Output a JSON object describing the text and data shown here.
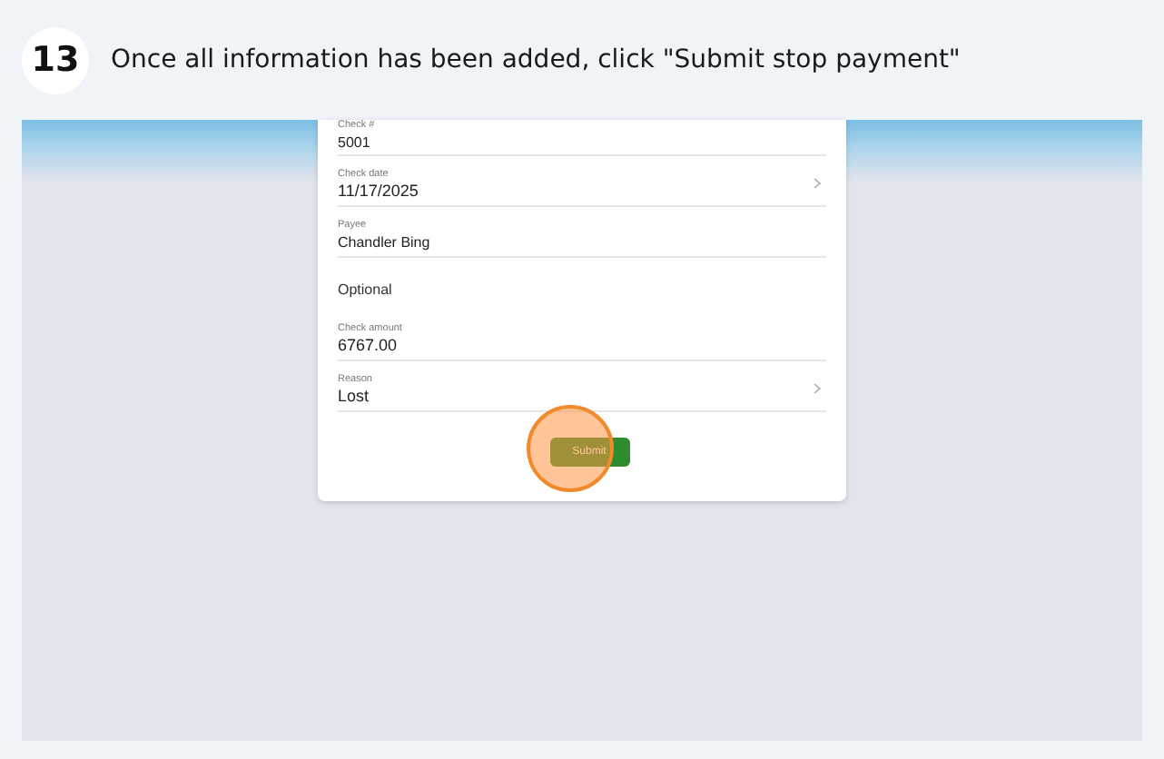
{
  "step": {
    "number": "13",
    "instruction": "Once all information has been added, click \"Submit stop payment\""
  },
  "form": {
    "fields": [
      {
        "kind": "text",
        "label": "Check #",
        "value": "5001"
      },
      {
        "kind": "select",
        "label": "Check date",
        "value": "11/17/2025"
      },
      {
        "kind": "text",
        "label": "Payee",
        "value": "Chandler Bing"
      },
      {
        "kind": "heading",
        "label": "Optional"
      },
      {
        "kind": "text",
        "label": "Check amount",
        "value": "6767.00"
      },
      {
        "kind": "select",
        "label": "Reason",
        "value": "Lost"
      }
    ],
    "submit": "Submit"
  }
}
